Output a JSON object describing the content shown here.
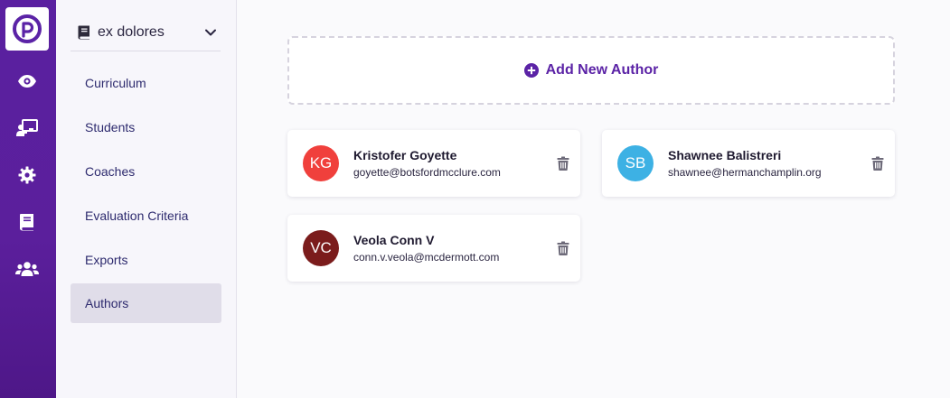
{
  "sidebar": {
    "course_name": "ex dolores",
    "items": [
      {
        "label": "Curriculum",
        "active": false
      },
      {
        "label": "Students",
        "active": false
      },
      {
        "label": "Coaches",
        "active": false
      },
      {
        "label": "Evaluation Criteria",
        "active": false
      },
      {
        "label": "Exports",
        "active": false
      },
      {
        "label": "Authors",
        "active": true
      }
    ]
  },
  "rail": {
    "icons": [
      "eye-icon",
      "chalkboard-teacher-icon",
      "gear-icon",
      "book-icon",
      "users-icon"
    ]
  },
  "main": {
    "add_author_label": "Add New Author",
    "authors": [
      {
        "initials": "KG",
        "name": "Kristofer Goyette",
        "email": "goyette@botsfordmcclure.com",
        "avatar_color": "#f0403c"
      },
      {
        "initials": "SB",
        "name": "Shawnee Balistreri",
        "email": "shawnee@hermanchamplin.org",
        "avatar_color": "#3db1e4"
      },
      {
        "initials": "VC",
        "name": "Veola Conn V",
        "email": "conn.v.veola@mcdermott.com",
        "avatar_color": "#7b1c1c"
      }
    ]
  },
  "colors": {
    "brand": "#5b23a6",
    "rail": "#5a20a0",
    "active_item": "#e0dde9"
  }
}
